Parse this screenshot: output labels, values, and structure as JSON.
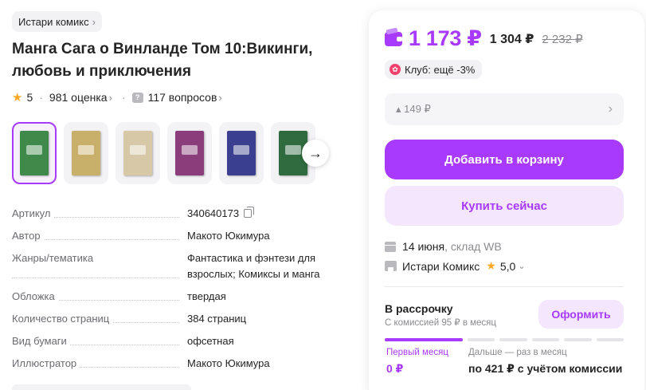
{
  "brand": {
    "name": "Истари комикс"
  },
  "product": {
    "title": "Манга Сага о Винланде Том 10:Викинги, любовь и приключения",
    "rating": "5",
    "reviews": "981 оценка",
    "questions": "117 вопросов"
  },
  "gallery": {
    "thumbs": [
      {
        "color": "#3f8a4a",
        "active": true
      },
      {
        "color": "#c9b06a",
        "active": false
      },
      {
        "color": "#d7c9a8",
        "active": false
      },
      {
        "color": "#8a3d7a",
        "active": false
      },
      {
        "color": "#3a3f8f",
        "active": false
      },
      {
        "color": "#2f6b3f",
        "active": false
      }
    ]
  },
  "specs": [
    {
      "label": "Артикул",
      "value": "340640173"
    },
    {
      "label": "Автор",
      "value": "Макото Юкимура"
    },
    {
      "label": "Жанры/тематика",
      "value": "Фантастика и фэнтези для взрослых; Комиксы и манга"
    },
    {
      "label": "Обложка",
      "value": "твердая"
    },
    {
      "label": "Количество страниц",
      "value": "384 страниц"
    },
    {
      "label": "Вид бумаги",
      "value": "офсетная"
    },
    {
      "label": "Иллюстратор",
      "value": "Макото Юкимура"
    }
  ],
  "pricing": {
    "price": "1 173 ₽",
    "card_price": "1 304 ₽",
    "old_price": "2 232 ₽",
    "club": "Клуб: ещё -3%",
    "installment": "▴ 149 ₽"
  },
  "actions": {
    "add_to_cart": "Добавить в корзину",
    "buy_now": "Купить сейчас"
  },
  "delivery": {
    "date": "14 июня",
    "warehouse": ", склад WB"
  },
  "seller": {
    "name": "Истари Комикс",
    "rating": "5,0"
  },
  "installment_plan": {
    "title": "В рассрочку",
    "subtitle": "С комиссией 95 ₽ в месяц",
    "button": "Оформить",
    "first_label": "Первый месяц",
    "first_value": "0 ₽",
    "next_label": "Дальше — раз в месяц",
    "next_value": "по 421 ₽ с учётом комиссии"
  },
  "colors": {
    "accent": "#a73afd",
    "accent_light": "#f4e6fd",
    "star": "#ffa726"
  }
}
